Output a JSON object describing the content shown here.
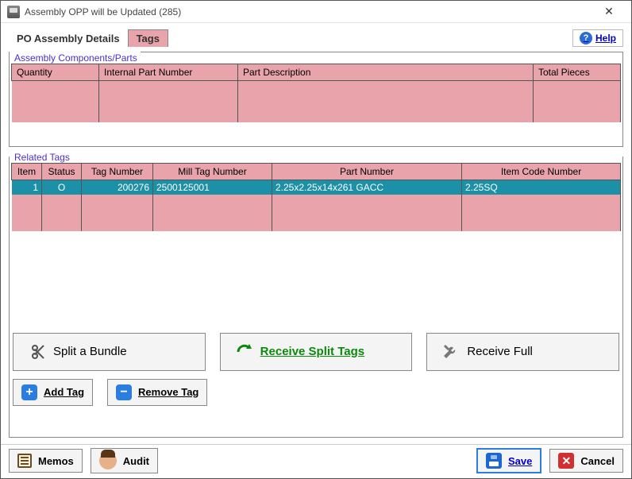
{
  "window": {
    "title": "Assembly OPP will be Updated  (285)"
  },
  "tabs": {
    "po_details": "PO Assembly Details",
    "tags": "Tags",
    "active": "tags"
  },
  "help": {
    "label": "Help"
  },
  "components_panel": {
    "legend": "Assembly Components/Parts",
    "columns": {
      "quantity": "Quantity",
      "internal_part": "Internal Part Number",
      "part_desc": "Part Description",
      "total_pieces": "Total Pieces"
    }
  },
  "related_tags_panel": {
    "legend": "Related Tags",
    "columns": {
      "item": "Item",
      "status": "Status",
      "tag_number": "Tag Number",
      "mill_tag_number": "Mill Tag Number",
      "part_number": "Part Number",
      "item_code_number": "Item Code Number"
    },
    "rows": [
      {
        "item": "1",
        "status": "O",
        "tag_number": "200276",
        "mill_tag_number": "2500125001",
        "part_number": "2.25x2.25x14x261 GACC",
        "item_code_number": "2.25SQ"
      }
    ]
  },
  "buttons": {
    "split_bundle": "Split a Bundle",
    "receive_split_tags": "Receive Split Tags",
    "receive_full": "Receive Full",
    "add_tag": "Add Tag",
    "remove_tag": "Remove Tag",
    "memos": "Memos",
    "audit": "Audit",
    "save": "Save",
    "cancel": "Cancel"
  }
}
